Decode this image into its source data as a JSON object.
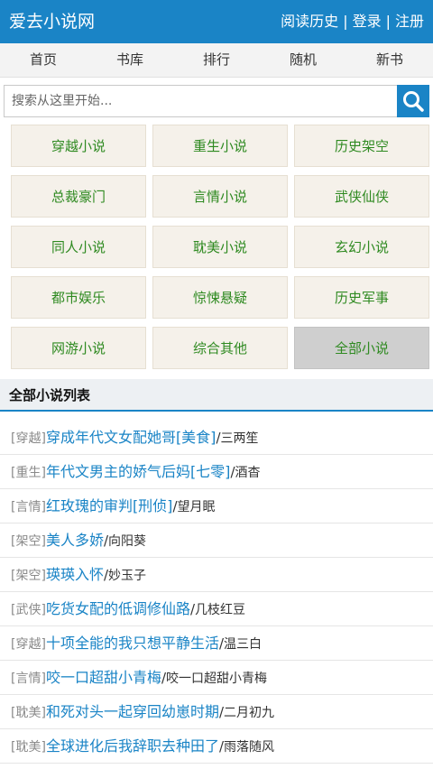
{
  "header": {
    "site_title": "爱去小说网",
    "links": [
      {
        "label": "阅读历史"
      },
      {
        "label": "登录"
      },
      {
        "label": "注册"
      }
    ],
    "separator": "|",
    "bg_color": "#1a84c6"
  },
  "nav": {
    "items": [
      {
        "label": "首页"
      },
      {
        "label": "书库"
      },
      {
        "label": "排行"
      },
      {
        "label": "随机"
      },
      {
        "label": "新书"
      }
    ]
  },
  "search": {
    "placeholder": "搜索从这里开始...",
    "value": "",
    "button_icon": "search-icon"
  },
  "categories": [
    {
      "label": "穿越小说",
      "active": false
    },
    {
      "label": "重生小说",
      "active": false
    },
    {
      "label": "历史架空",
      "active": false
    },
    {
      "label": "总裁豪门",
      "active": false
    },
    {
      "label": "言情小说",
      "active": false
    },
    {
      "label": "武侠仙侠",
      "active": false
    },
    {
      "label": "同人小说",
      "active": false
    },
    {
      "label": "耽美小说",
      "active": false
    },
    {
      "label": "玄幻小说",
      "active": false
    },
    {
      "label": "都市娱乐",
      "active": false
    },
    {
      "label": "惊悚悬疑",
      "active": false
    },
    {
      "label": "历史军事",
      "active": false
    },
    {
      "label": "网游小说",
      "active": false
    },
    {
      "label": "综合其他",
      "active": false
    },
    {
      "label": "全部小说",
      "active": true
    }
  ],
  "list": {
    "title": "全部小说列表",
    "slash": "/",
    "books": [
      {
        "tag": "[穿越]",
        "title": "穿成年代文女配她哥[美食]",
        "author": "三两笙"
      },
      {
        "tag": "[重生]",
        "title": "年代文男主的娇气后妈[七零]",
        "author": "酒杳"
      },
      {
        "tag": "[言情]",
        "title": "红玫瑰的审判[刑侦]",
        "author": "望月眠"
      },
      {
        "tag": "[架空]",
        "title": "美人多娇",
        "author": "向阳葵"
      },
      {
        "tag": "[架空]",
        "title": "瑛瑛入怀",
        "author": "妙玉子"
      },
      {
        "tag": "[武侠]",
        "title": "吃货女配的低调修仙路",
        "author": "几枝红豆"
      },
      {
        "tag": "[穿越]",
        "title": "十项全能的我只想平静生活",
        "author": "温三白"
      },
      {
        "tag": "[言情]",
        "title": "咬一口超甜小青梅",
        "author": "咬一口超甜小青梅"
      },
      {
        "tag": "[耽美]",
        "title": "和死对头一起穿回幼崽时期",
        "author": "二月初九"
      },
      {
        "tag": "[耽美]",
        "title": "全球进化后我辞职去种田了",
        "author": "雨落随风"
      }
    ]
  }
}
